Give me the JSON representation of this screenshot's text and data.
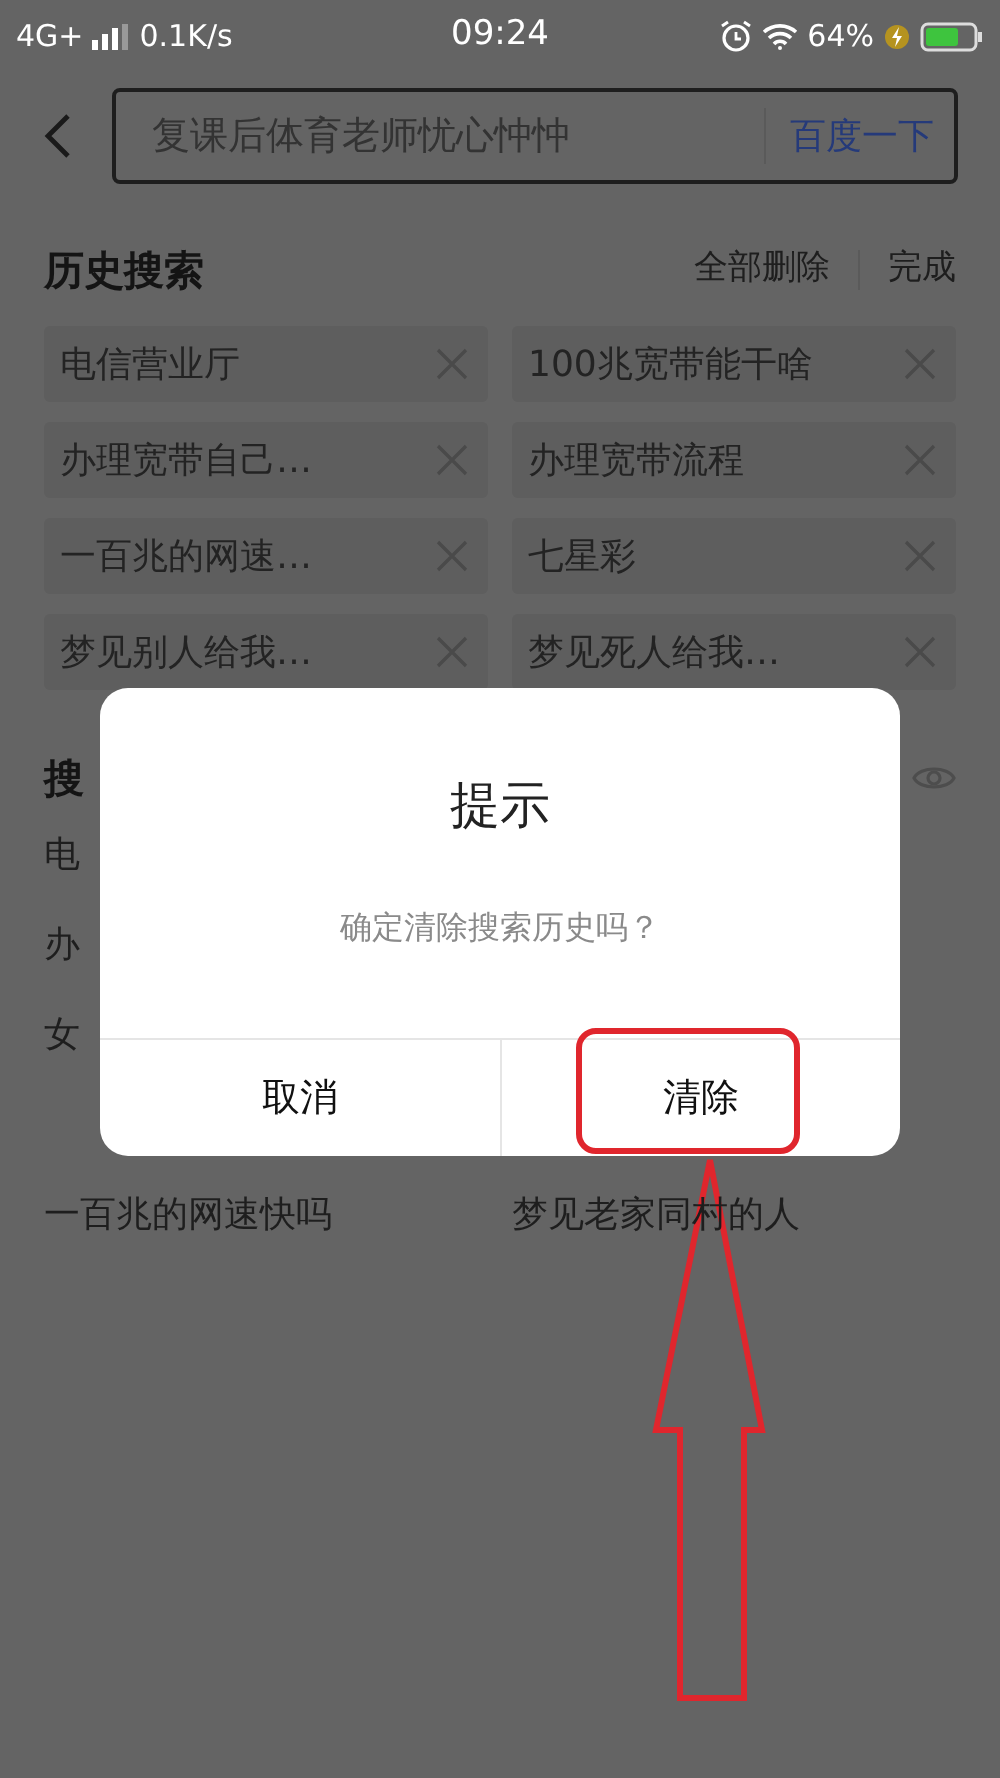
{
  "status_bar": {
    "network": "4G+",
    "speed": "0.1K/s",
    "time": "09:24",
    "battery": "64%"
  },
  "search": {
    "placeholder": "复课后体育老师忧心忡忡",
    "button": "百度一下"
  },
  "history": {
    "title": "历史搜索",
    "actions": [
      "全部删除",
      "完成"
    ],
    "items": [
      {
        "text": "电信营业厅"
      },
      {
        "text": "100兆宽带能干啥"
      },
      {
        "text": "办理宽带自己…"
      },
      {
        "text": "办理宽带流程"
      },
      {
        "text": "一百兆的网速…"
      },
      {
        "text": "七星彩"
      },
      {
        "text": "梦见别人给我…"
      },
      {
        "text": "梦见死人给我…"
      }
    ]
  },
  "hot": {
    "title": "搜",
    "rows": [
      {
        "left": "电"
      },
      {
        "left": "办"
      },
      {
        "left": "女"
      },
      {
        "left": "一百兆的网速快吗",
        "right": "梦见老家同村的人"
      }
    ]
  },
  "dialog": {
    "title": "提示",
    "message": "确定清除搜索历史吗？",
    "buttons": [
      "取消",
      "清除"
    ]
  }
}
